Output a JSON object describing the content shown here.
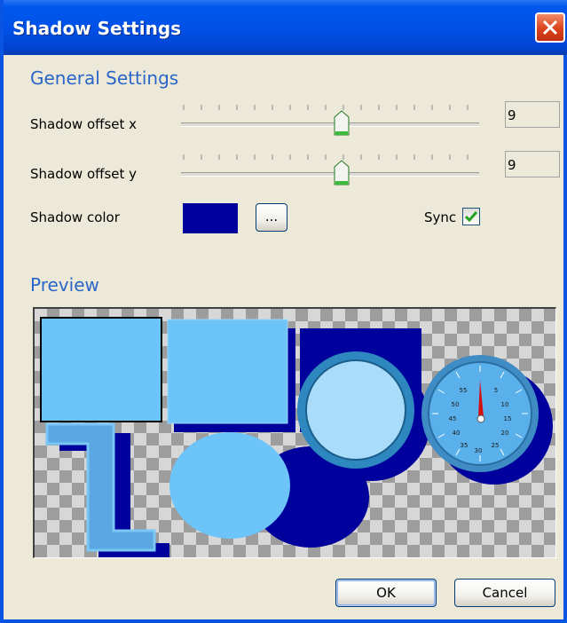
{
  "window": {
    "title": "Shadow Settings"
  },
  "general": {
    "heading": "General Settings",
    "offset_x": {
      "label": "Shadow offset x",
      "value": "9"
    },
    "offset_y": {
      "label": "Shadow offset y",
      "value": "9"
    },
    "color": {
      "label": "Shadow color",
      "swatch": "#00009C",
      "browse_label": "..."
    },
    "sync": {
      "label": "Sync",
      "checked": true
    }
  },
  "preview": {
    "heading": "Preview",
    "gauge_ticks": [
      "55",
      "50",
      "45",
      "40",
      "35",
      "30",
      "25",
      "20",
      "15",
      "10",
      "5"
    ]
  },
  "buttons": {
    "ok": "OK",
    "cancel": "Cancel"
  },
  "colors": {
    "title_bar": "#0054E3",
    "section_text": "#2A66C9",
    "shape_fill": "#6CC4F9",
    "shadow": "#00009C"
  }
}
